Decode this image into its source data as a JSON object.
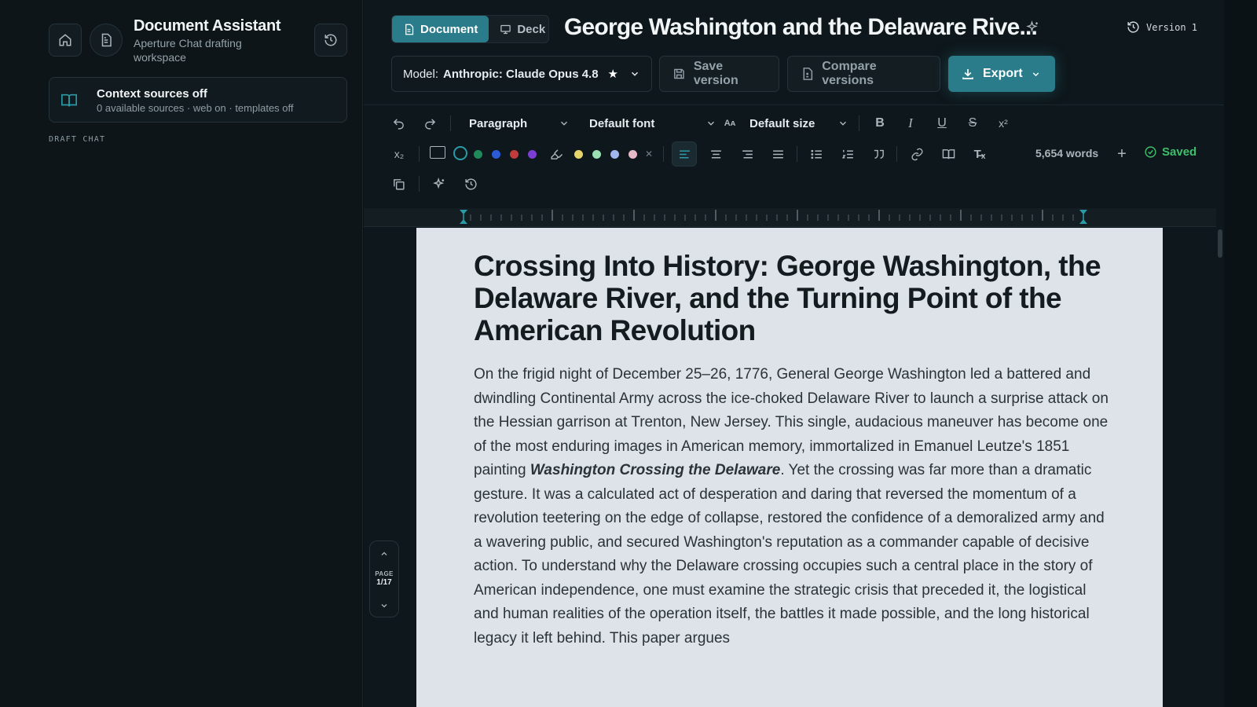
{
  "sidebar": {
    "app_title": "Document Assistant",
    "app_subtitle": "Aperture Chat drafting workspace",
    "context": {
      "title": "Context sources off",
      "subtitle": "0 available sources · web on · templates off"
    },
    "section_label": "DRAFT CHAT"
  },
  "header": {
    "tabs": [
      {
        "label": "Document",
        "active": true
      },
      {
        "label": "Deck",
        "active": false
      }
    ],
    "doc_title": "George Washington and the Delaware Rive...",
    "version_label": "Version 1",
    "model_prefix": "Model:",
    "model_name": "Anthropic: Claude Opus 4.8",
    "save_version": "Save version",
    "compare_versions": "Compare versions",
    "export": "Export"
  },
  "toolbar": {
    "block_style": "Paragraph",
    "font": "Default font",
    "size": "Default size",
    "word_count": "5,654 words",
    "saved": "Saved",
    "text_colors": [
      "#0f1a1e",
      "#1f8a5a",
      "#2b5bd7",
      "#c23b3b",
      "#7b3fd4"
    ],
    "highlight_colors": [
      "#e8d56a",
      "#9be0b4",
      "#9fb6ee",
      "#e5b9c6"
    ]
  },
  "document": {
    "heading": "Crossing Into History: George Washington, the Delaware River, and the Turning Point of the American Revolution",
    "p_before": "On the frigid night of December 25–26, 1776, General George Washington led a battered and dwindling Continental Army across the ice-choked Delaware River to launch a surprise attack on the Hessian garrison at Trenton, New Jersey. This single, audacious maneuver has become one of the most enduring images in American memory, immortalized in Emanuel Leutze's 1851 painting ",
    "p_italic": "Washington Crossing the Delaware",
    "p_after": ". Yet the crossing was far more than a dramatic gesture. It was a calculated act of desperation and daring that reversed the momentum of a revolution teetering on the edge of collapse, restored the confidence of a demoralized army and a wavering public, and secured Washington's reputation as a commander capable of decisive action. To understand why the Delaware crossing occupies such a central place in the story of American independence, one must examine the strategic crisis that preceded it, the logistical and human realities of the operation itself, the battles it made possible, and the long historical legacy it left behind. This paper argues"
  },
  "pager": {
    "label": "PAGE",
    "value": "1/17"
  }
}
